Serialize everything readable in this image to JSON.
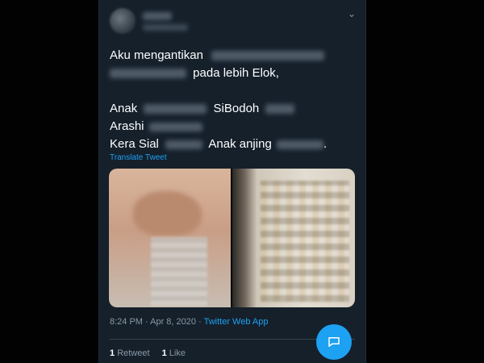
{
  "tweet": {
    "lines": [
      {
        "parts": [
          "Aku mengantikan",
          ""
        ]
      },
      {
        "parts": [
          "",
          "pada lebih Elok,"
        ]
      },
      {
        "parts": []
      },
      {
        "parts": [
          "Anak",
          "",
          "SiBodoh",
          ""
        ]
      },
      {
        "parts": [
          "Arashi",
          ""
        ]
      },
      {
        "parts": [
          "Kera Sial",
          "",
          "Anak anjing",
          "",
          "."
        ]
      }
    ],
    "translate_label": "Translate Tweet",
    "timestamp": "8:24 PM · Apr 8, 2020 ·",
    "source_app": "Twitter Web App",
    "retweets_count": "1",
    "retweets_label": "Retweet",
    "likes_count": "1",
    "likes_label": "Like"
  },
  "icons": {
    "caret": "chevron-down-icon",
    "compose": "compose-reply-icon"
  },
  "colors": {
    "background": "#15202b",
    "accent": "#1da1f2",
    "secondary_text": "#8899a6"
  }
}
